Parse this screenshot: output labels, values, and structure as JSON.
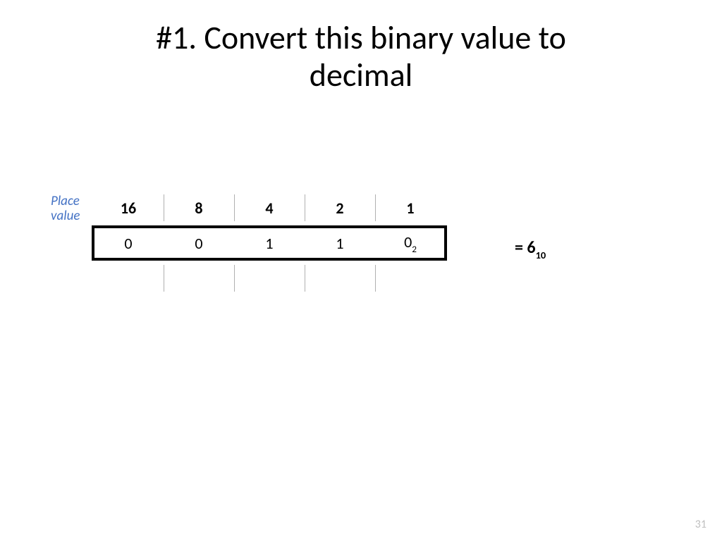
{
  "title_line1": "#1. Convert this binary value to",
  "title_line2": "decimal",
  "place_label_line1": "Place",
  "place_label_line2": "value",
  "place_values": [
    "16",
    "8",
    "4",
    "2",
    "1"
  ],
  "binary_digits": [
    "0",
    "0",
    "1",
    "1",
    "0"
  ],
  "binary_base": "2",
  "result_prefix": "= ",
  "result_value": "6",
  "result_base": "10",
  "page_number": "31"
}
